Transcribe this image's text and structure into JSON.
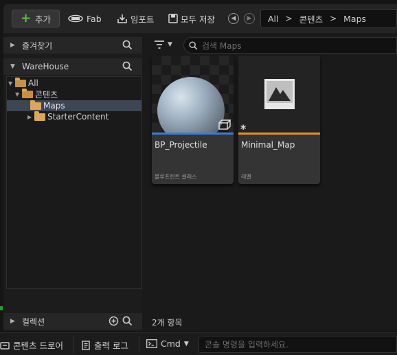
{
  "toolbar": {
    "add_label": "추가",
    "fab_label": "Fab",
    "import_label": "임포트",
    "saveall_label": "모두 저장"
  },
  "breadcrumb": [
    "All",
    "콘텐츠",
    "Maps"
  ],
  "sidebar": {
    "favorites_label": "즐겨찾기",
    "project_label": "WareHouse",
    "tree": [
      {
        "label": "All",
        "depth": 0,
        "expanded": true
      },
      {
        "label": "콘텐츠",
        "depth": 1,
        "expanded": true
      },
      {
        "label": "Maps",
        "depth": 2,
        "selected": true
      },
      {
        "label": "StarterContent",
        "depth": 1,
        "expanded": false
      }
    ],
    "collections_label": "컬렉션"
  },
  "search": {
    "placeholder": "검색 Maps"
  },
  "assets": [
    {
      "name": "BP_Projectile",
      "type": "블루프린트 클래스",
      "accent": "#3e7bd6"
    },
    {
      "name": "Minimal_Map",
      "type": "레벨",
      "accent": "#e8902a"
    }
  ],
  "item_count": "2개 항목",
  "bottom": {
    "drawer_label": "콘텐츠 드로어",
    "log_label": "출력 로그",
    "cmd_label": "Cmd",
    "cmd_placeholder": "콘솔 명령을 입력하세요."
  }
}
